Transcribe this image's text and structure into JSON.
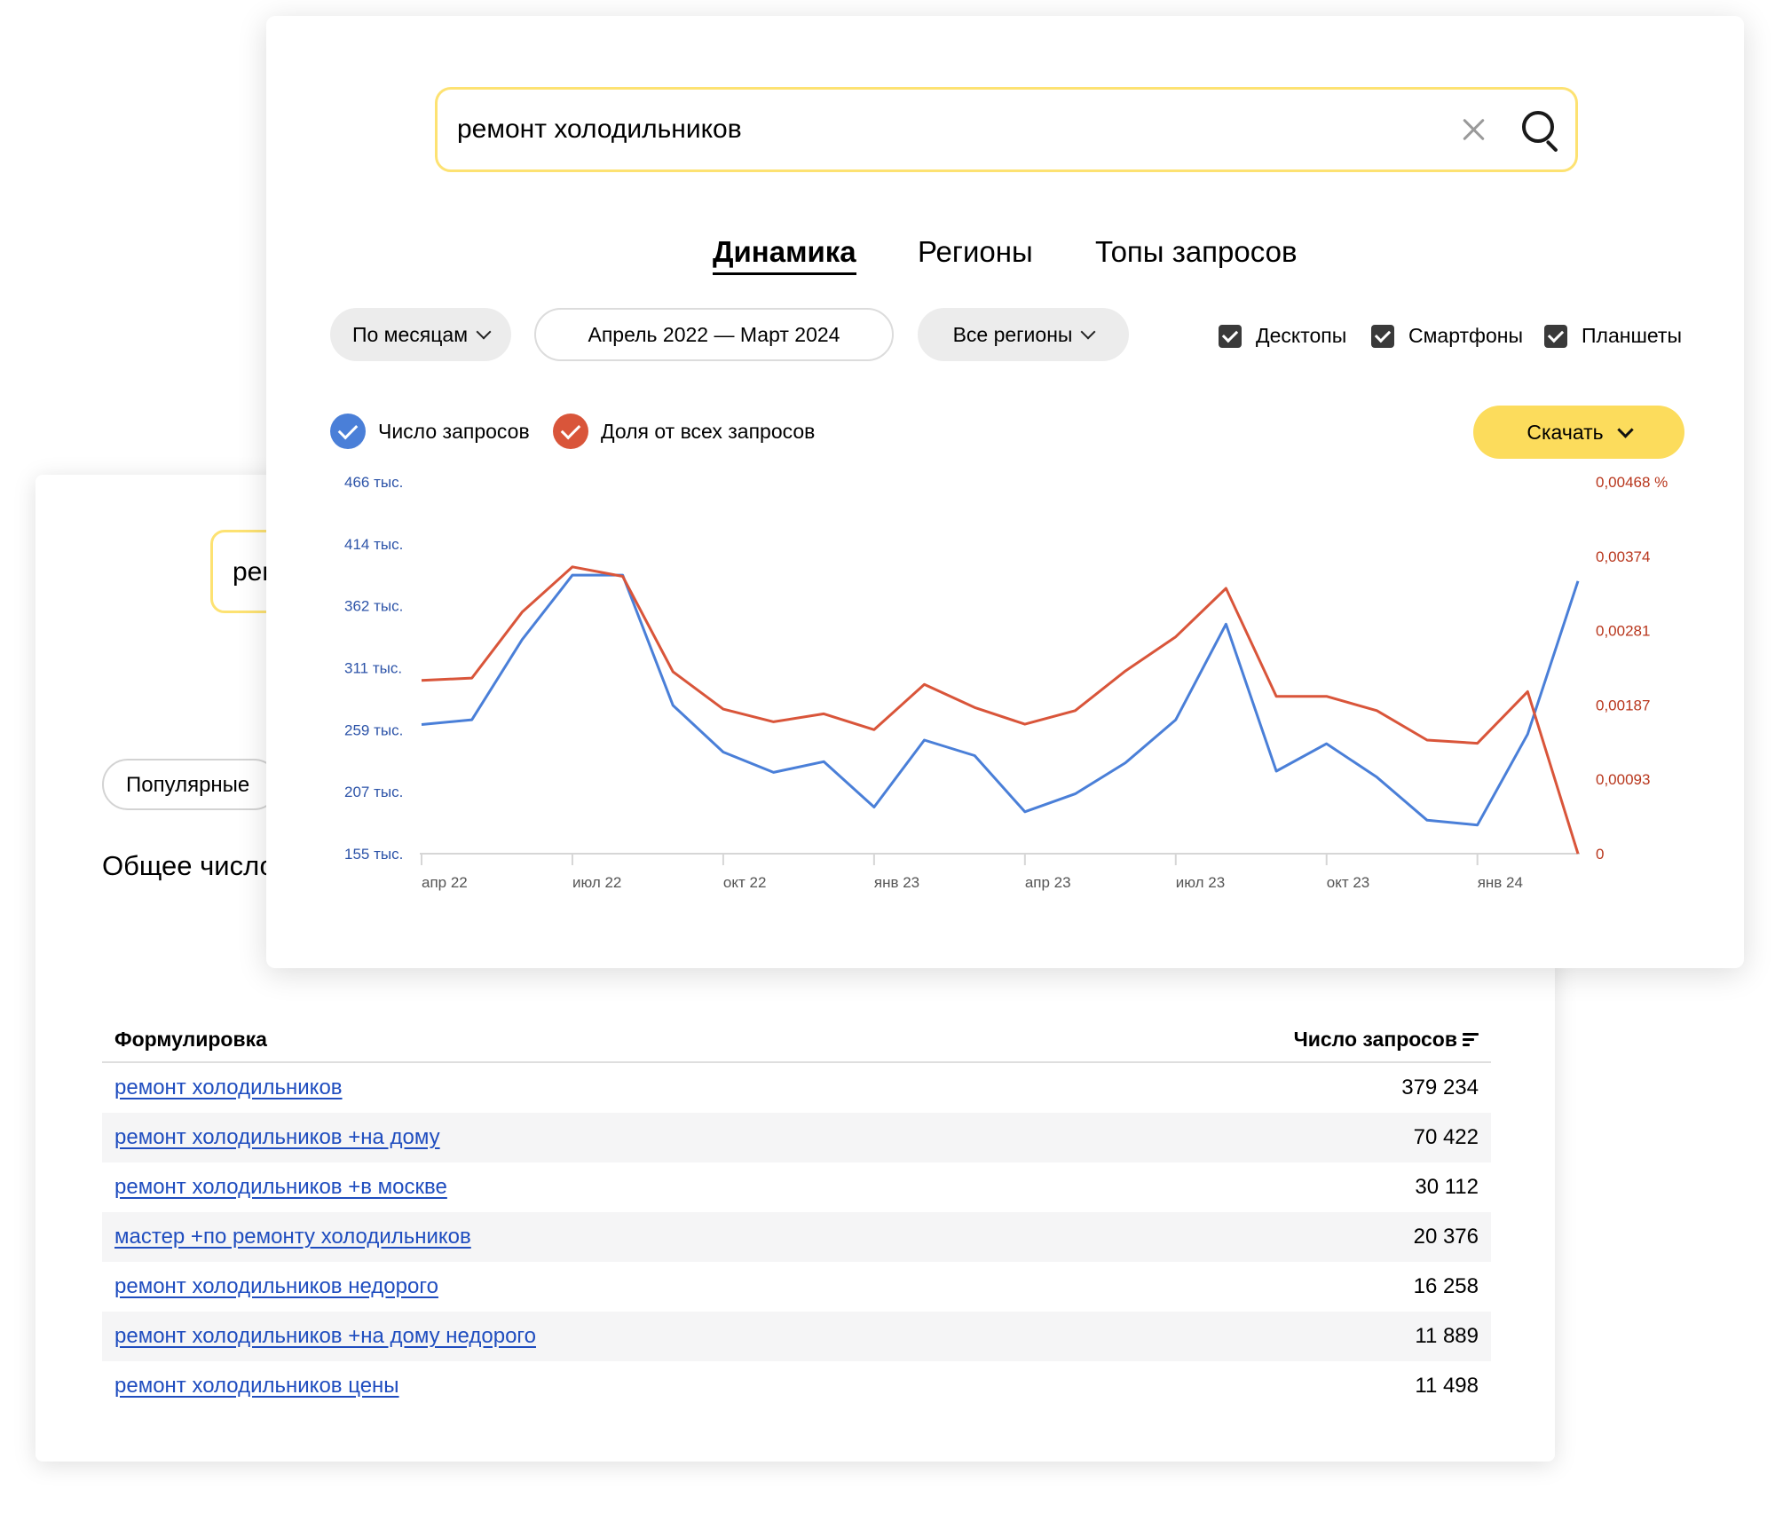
{
  "back_panel": {
    "search_fragment": "рем",
    "pill_label": "Популярные",
    "heading_fragment": "Общее число",
    "table": {
      "col_query": "Формулировка",
      "col_count": "Число запросов",
      "rows": [
        {
          "query": "ремонт холодильников",
          "count": "379 234"
        },
        {
          "query": "ремонт холодильников +на дому",
          "count": "70 422"
        },
        {
          "query": "ремонт холодильников +в москве",
          "count": "30 112"
        },
        {
          "query": "мастер +по ремонту холодильников",
          "count": "20 376"
        },
        {
          "query": "ремонт холодильников недорого",
          "count": "16 258"
        },
        {
          "query": "ремонт холодильников +на дому недорого",
          "count": "11 889"
        },
        {
          "query": "ремонт холодильников цены",
          "count": "11 498"
        }
      ]
    }
  },
  "search": {
    "value": "ремонт холодильников",
    "clear_icon": "close-icon",
    "search_icon": "search-icon"
  },
  "tabs": [
    {
      "label": "Динамика",
      "active": true
    },
    {
      "label": "Регионы",
      "active": false
    },
    {
      "label": "Топы запросов",
      "active": false
    }
  ],
  "filters": {
    "period": "По месяцам",
    "date_range": "Апрель 2022 — Март 2024",
    "region": "Все регионы",
    "devices": [
      {
        "label": "Десктопы",
        "checked": true
      },
      {
        "label": "Смартфоны",
        "checked": true
      },
      {
        "label": "Планшеты",
        "checked": true
      }
    ]
  },
  "legend": {
    "requests": "Число запросов",
    "share": "Доля от всех запросов"
  },
  "download_label": "Скачать",
  "colors": {
    "requests": "#4a7fd8",
    "share": "#d9553a",
    "accent_yellow": "#fcdc5c",
    "link": "#1f4dbf"
  },
  "chart_data": {
    "type": "line",
    "x_labels": [
      "апр 22",
      "июл 22",
      "окт 22",
      "янв 23",
      "апр 23",
      "июл 23",
      "окт 23",
      "янв 24"
    ],
    "x": [
      "2022-04",
      "2022-05",
      "2022-06",
      "2022-07",
      "2022-08",
      "2022-09",
      "2022-10",
      "2022-11",
      "2022-12",
      "2023-01",
      "2023-02",
      "2023-03",
      "2023-04",
      "2023-05",
      "2023-06",
      "2023-07",
      "2023-08",
      "2023-09",
      "2023-10",
      "2023-11",
      "2023-12",
      "2024-01",
      "2024-02",
      "2024-03"
    ],
    "left_axis": {
      "ticks": [
        "466 тыс.",
        "414 тыс.",
        "362 тыс.",
        "311 тыс.",
        "259 тыс.",
        "207 тыс.",
        "155 тыс."
      ],
      "ylim": [
        155,
        466
      ],
      "unit": "тыс."
    },
    "right_axis": {
      "ticks": [
        "0,00468 %",
        "0,00374",
        "0,00281",
        "0,00187",
        "0,00093",
        "0"
      ],
      "ylim": [
        0,
        0.00468
      ]
    },
    "series": [
      {
        "name": "Число запросов",
        "axis": "left",
        "values": [
          263,
          267,
          334,
          388,
          388,
          279,
          240,
          223,
          232,
          194,
          250,
          237,
          190,
          205,
          231,
          267,
          347,
          224,
          247,
          219,
          183,
          179,
          255,
          383
        ]
      },
      {
        "name": "Доля от всех запросов",
        "axis": "right",
        "values": [
          0.00218,
          0.00221,
          0.00304,
          0.00361,
          0.00349,
          0.00229,
          0.00182,
          0.00166,
          0.00176,
          0.00156,
          0.00213,
          0.00184,
          0.00163,
          0.0018,
          0.0023,
          0.00273,
          0.00334,
          0.00198,
          0.00198,
          0.0018,
          0.00143,
          0.00139,
          0.00204,
          0.0
        ]
      }
    ],
    "grid": false
  }
}
